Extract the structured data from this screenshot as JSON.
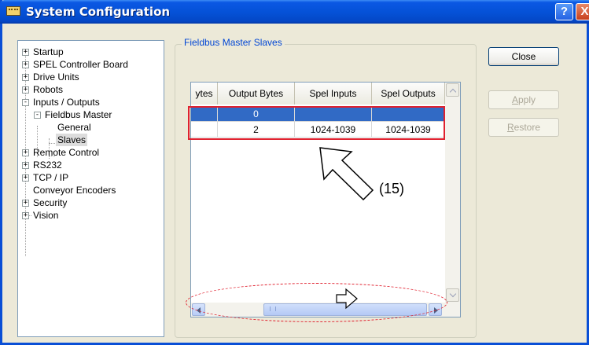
{
  "window": {
    "title": "System Configuration",
    "help_glyph": "?",
    "close_glyph": "X"
  },
  "tree": {
    "items": [
      {
        "label": "Startup",
        "expander": "+"
      },
      {
        "label": "SPEL Controller Board",
        "expander": "+"
      },
      {
        "label": "Drive Units",
        "expander": "+"
      },
      {
        "label": "Robots",
        "expander": "+"
      },
      {
        "label": "Inputs / Outputs",
        "expander": "-"
      },
      {
        "label": "Fieldbus Master",
        "expander": "-"
      },
      {
        "label": "General",
        "expander": ""
      },
      {
        "label": "Slaves",
        "expander": ""
      },
      {
        "label": "Remote Control",
        "expander": "+"
      },
      {
        "label": "RS232",
        "expander": "+"
      },
      {
        "label": "TCP / IP",
        "expander": "+"
      },
      {
        "label": "Conveyor Encoders",
        "expander": ""
      },
      {
        "label": "Security",
        "expander": "+"
      },
      {
        "label": "Vision",
        "expander": "+"
      }
    ]
  },
  "group": {
    "title": "Fieldbus Master Slaves"
  },
  "grid": {
    "columns": [
      "ytes",
      "Output Bytes",
      "Spel Inputs",
      "Spel Outputs"
    ],
    "rows": [
      {
        "c0": "",
        "c1": "0",
        "c2": "",
        "c3": ""
      },
      {
        "c0": "",
        "c1": "2",
        "c2": "1024-1039",
        "c3": "1024-1039"
      }
    ]
  },
  "buttons": {
    "close": "Close",
    "apply_first": "A",
    "apply_rest": "pply",
    "restore_first": "R",
    "restore_rest": "estore"
  },
  "annotation": {
    "callout": "(15)",
    "accent_color": "#e0212f"
  }
}
